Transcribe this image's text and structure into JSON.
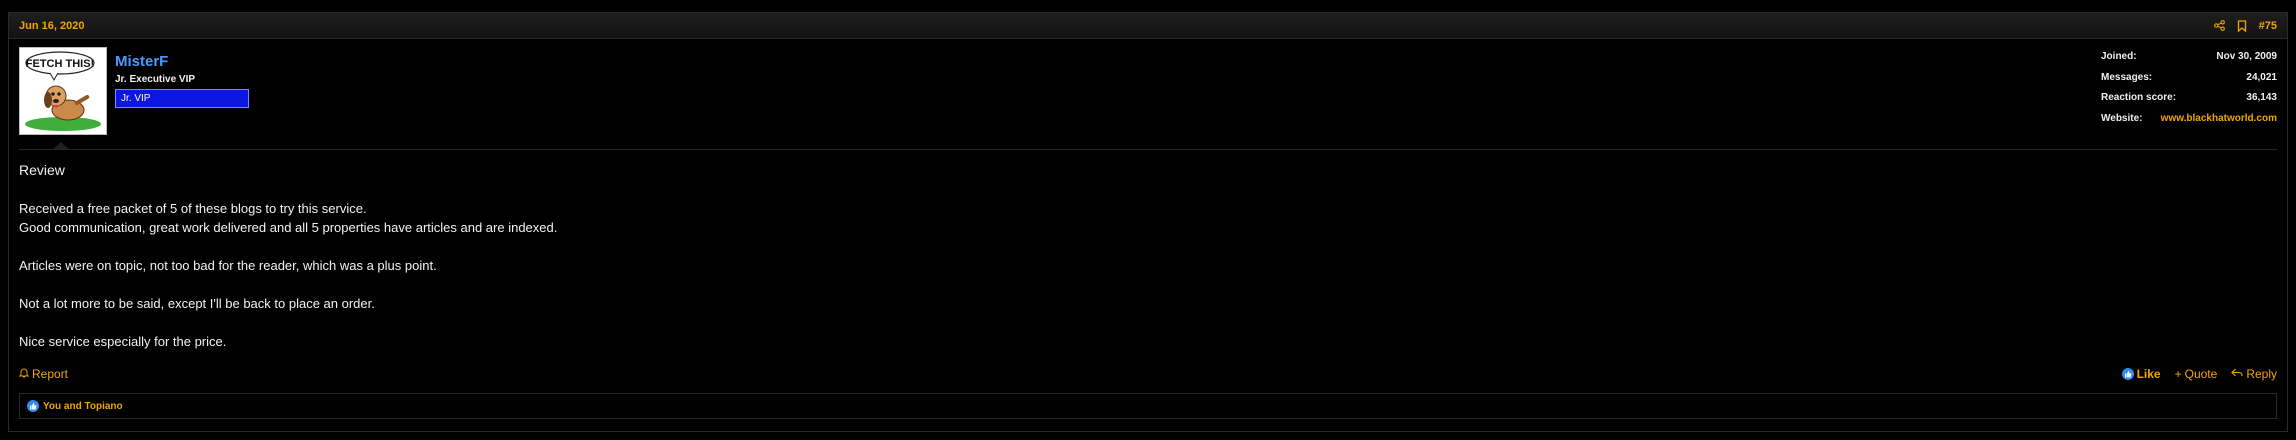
{
  "post": {
    "date": "Jun 16, 2020",
    "number": "#75",
    "icons": [
      "share-icon",
      "bookmark-icon"
    ]
  },
  "user": {
    "name": "MisterF",
    "title": "Jr. Executive VIP",
    "banner": "Jr. VIP",
    "avatar_caption": "FETCH THIS!"
  },
  "stats": {
    "joined_label": "Joined:",
    "joined_value": "Nov 30, 2009",
    "messages_label": "Messages:",
    "messages_value": "24,021",
    "reaction_label": "Reaction score:",
    "reaction_value": "36,143",
    "website_label": "Website:",
    "website_value": "www.blackhatworld.com"
  },
  "content": {
    "title": "Review",
    "line1": "Received a free packet of 5 of these blogs to try this service.",
    "line2": "Good communication, great work delivered and all 5 properties have articles and are indexed.",
    "line3": "Articles were on topic, not too bad for the reader, which was a plus point.",
    "line4": "Not a lot more to be said, except I'll be back to place an order.",
    "line5": "Nice service especially for the price."
  },
  "actions": {
    "report": "Report",
    "like": "Like",
    "quote": "Quote",
    "reply": "Reply"
  },
  "reactions": {
    "text": "You and Topiano"
  },
  "colors": {
    "accent": "#f0a500",
    "username": "#4a9bff",
    "banner_bg": "#0b17e0",
    "like_blue": "#2f8cf0"
  }
}
